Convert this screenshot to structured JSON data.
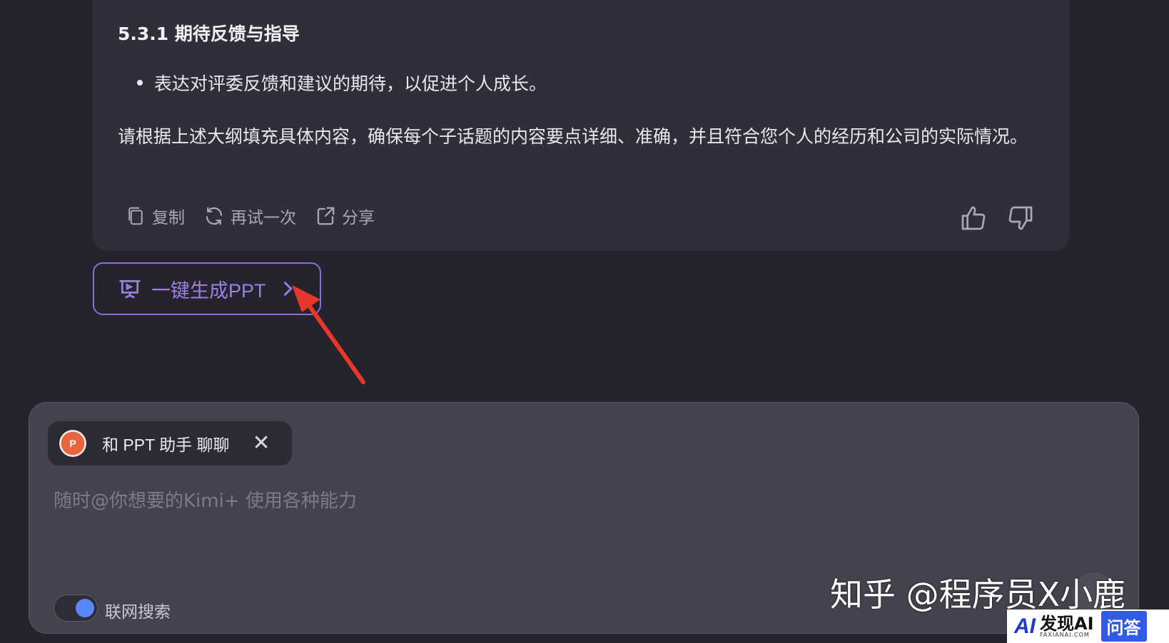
{
  "message": {
    "heading": "5.3.1 期待反馈与指导",
    "bullet": "表达对评委反馈和建议的期待，以促进个人成长。",
    "paragraph": "请根据上述大纲填充具体内容，确保每个子话题的内容要点详细、准确，并且符合您个人的经历和公司的实际情况。",
    "actions": {
      "copy": "复制",
      "retry": "再试一次",
      "share": "分享"
    },
    "icons": {
      "copy": "copy-icon",
      "retry": "refresh-icon",
      "share": "share-icon",
      "like": "thumbs-up-icon",
      "dislike": "thumbs-down-icon"
    }
  },
  "ppt_button": {
    "label": "一键生成PPT",
    "icon": "presentation-icon",
    "accent": "#8a6fd6"
  },
  "composer": {
    "chip_label": "和 PPT 助手 聊聊",
    "chip_logo_text": "P",
    "placeholder": "随时@你想要的Kimi+ 使用各种能力",
    "toggle_label": "联网搜索",
    "toggle_on": true
  },
  "watermarks": {
    "zhihu": "知乎 @程序员X小鹿",
    "logo_ai": "AI",
    "logo_text": "发现AI",
    "logo_sub": "FAXIANAI.COM",
    "logo_badge": "问答"
  },
  "annotation": {
    "color": "#e8372a"
  }
}
